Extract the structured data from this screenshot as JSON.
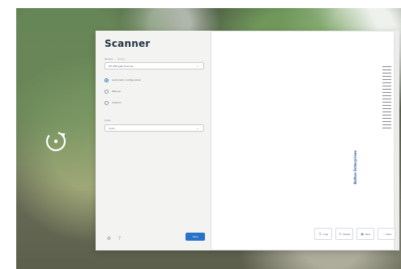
{
  "app": {
    "title": "Scanner"
  },
  "scanner": {
    "source_label": "Source",
    "source_state": "Ready",
    "source_value": "HP OfficeJet Scanner",
    "options": [
      "Automatic configuration",
      "Manual",
      "Custom"
    ],
    "color_label": "Color",
    "color_value": "Color",
    "scan_button": "Scan"
  },
  "document": {
    "company": "Bolton Enterprises"
  },
  "toolbar": {
    "buttons": [
      "Crop",
      "Rotate",
      "Save",
      "More"
    ]
  },
  "icons": {
    "rotate": "rotate-icon",
    "settings": "settings-icon",
    "help": "help-icon"
  }
}
